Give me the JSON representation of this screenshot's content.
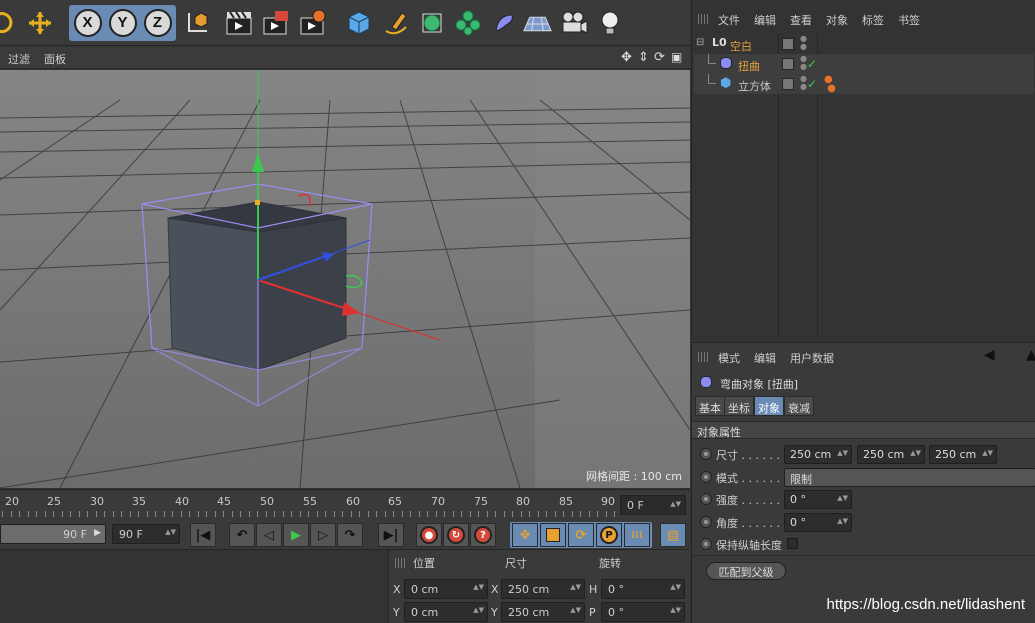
{
  "viewport_menu": {
    "filter": "过滤",
    "panel": "面板"
  },
  "toolbar": {
    "axis_x": "X",
    "axis_y": "Y",
    "axis_z": "Z"
  },
  "viewport": {
    "grid_spacing": "网格间距 : 100 cm"
  },
  "timeline": {
    "ticks": [
      "20",
      "25",
      "30",
      "35",
      "40",
      "45",
      "50",
      "55",
      "60",
      "65",
      "70",
      "75",
      "80",
      "85",
      "90"
    ],
    "current_frame": "0 F"
  },
  "transport": {
    "end_frame_slider": "90 F",
    "end_frame": "90 F"
  },
  "object_manager": {
    "menu": [
      "文件",
      "编辑",
      "查看",
      "对象",
      "标签",
      "书签"
    ],
    "objects": [
      {
        "name": "空白",
        "color": "#e8a23a"
      },
      {
        "name": "扭曲",
        "color": "#e8a23a"
      },
      {
        "name": "立方体",
        "color": "#c8c8c8"
      }
    ]
  },
  "attribute_manager": {
    "menu": [
      "模式",
      "编辑",
      "用户数据"
    ],
    "object_title": "弯曲对象 [扭曲]",
    "tabs": [
      "基本",
      "坐标",
      "对象",
      "衰减"
    ],
    "active_tab": "对象",
    "section": "对象属性",
    "props": {
      "size_label": "尺寸 . . . . . . . .",
      "size": [
        "250 cm",
        "250 cm",
        "250 cm"
      ],
      "mode_label": "模式 . . . . . . . .",
      "mode": "限制",
      "strength_label": "强度 . . . . . . . .",
      "strength": "0 °",
      "angle_label": "角度 . . . . . . . .",
      "angle": "0 °",
      "keep_length_label": "保持纵轴长度"
    },
    "match_parent": "匹配到父级"
  },
  "coords": {
    "headers": {
      "position": "位置",
      "size": "尺寸",
      "rotation": "旋转"
    },
    "rows": [
      {
        "a": "X",
        "pos": "0 cm",
        "b": "X",
        "size": "250 cm",
        "c": "H",
        "rot": "0 °"
      },
      {
        "a": "Y",
        "pos": "0 cm",
        "b": "Y",
        "size": "250 cm",
        "c": "P",
        "rot": "0 °"
      }
    ]
  },
  "watermark": "https://blog.csdn.net/lidashent",
  "colors": {
    "accent": "#6a8cb4",
    "axis_x": "#e03030",
    "axis_y": "#30c040",
    "axis_z": "#3050e0",
    "deformer_box": "#9a8cf0"
  }
}
